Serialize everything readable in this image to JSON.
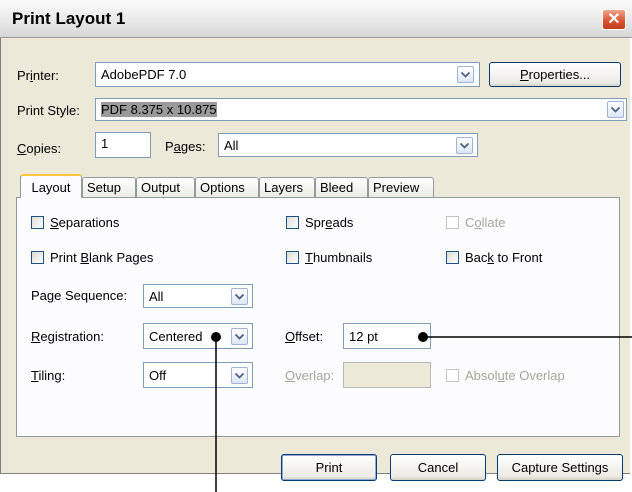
{
  "window": {
    "title": "Print Layout 1"
  },
  "printer": {
    "label_pre": "Pr",
    "label_u": "i",
    "label_post": "nter:",
    "value": "AdobePDF 7.0"
  },
  "properties_button": {
    "pre": "",
    "u": "P",
    "post": "roperties..."
  },
  "print_style": {
    "label": "Print Style:",
    "value": "PDF 8.375 x 10.875"
  },
  "copies": {
    "label_u": "C",
    "label_post": "opies:",
    "value": "1"
  },
  "pages": {
    "label_pre": "P",
    "label_u": "a",
    "label_post": "ges:",
    "value": "All"
  },
  "tabs": [
    "Layout",
    "Setup",
    "Output",
    "Options",
    "Layers",
    "Bleed",
    "Preview"
  ],
  "layout": {
    "separations": {
      "pre": "",
      "u": "S",
      "post": "eparations"
    },
    "spreads": {
      "pre": "Spr",
      "u": "e",
      "post": "ads"
    },
    "collate": {
      "pre": "C",
      "u": "o",
      "post": "llate"
    },
    "print_blank_pages": {
      "pre": "Print ",
      "u": "B",
      "post": "lank Pages"
    },
    "thumbnails": {
      "pre": "",
      "u": "T",
      "post": "humbnails"
    },
    "back_to_front": {
      "pre": "Bac",
      "u": "k",
      "post": " to Front"
    },
    "page_sequence": {
      "pre": "Pa",
      "u": "g",
      "post": "e Sequence:",
      "value": "All"
    },
    "registration": {
      "pre": "",
      "u": "R",
      "post": "egistration:",
      "value": "Centered"
    },
    "offset": {
      "pre": "",
      "u": "O",
      "post": "ffset:",
      "value": "12 pt"
    },
    "tiling": {
      "pre": "",
      "u": "T",
      "post": "iling:",
      "value": "Off"
    },
    "overlap": {
      "pre": "",
      "u": "O",
      "post": "verlap:",
      "value": ""
    },
    "absolute_overlap": {
      "pre": "Absol",
      "u": "u",
      "post": "te Overlap"
    }
  },
  "buttons": {
    "print": "Print",
    "cancel": "Cancel",
    "capture": "Capture Settings"
  }
}
